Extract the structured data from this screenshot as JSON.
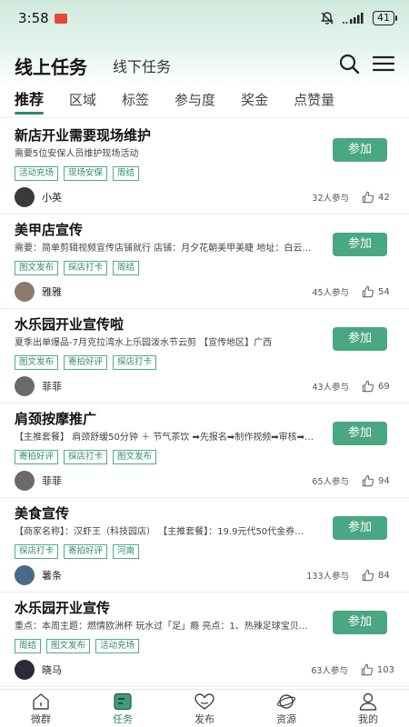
{
  "status": {
    "time": "3:58",
    "battery": "41"
  },
  "top_nav": {
    "online": "线上任务",
    "offline": "线下任务"
  },
  "tabs": [
    "推荐",
    "区域",
    "标签",
    "参与度",
    "奖金",
    "点赞量"
  ],
  "join_label": "参加",
  "tasks": [
    {
      "title": "新店开业需要现场维护",
      "desc": "需要5位安保人员维护现场活动",
      "tags": [
        "活动充场",
        "现场安保",
        "周结"
      ],
      "user": "小英",
      "participants": "32人参与",
      "likes": "42",
      "avatar_color": "#3a3a3a"
    },
    {
      "title": "美甲店宣传",
      "desc": "需要：简单剪辑视频宣传店铺就行 店铺：月夕花朝美甲美睫 地址：白云…",
      "tags": [
        "图文发布",
        "探店打卡",
        "周结"
      ],
      "user": "雅雅",
      "participants": "45人参与",
      "likes": "54",
      "avatar_color": "#8a7a6a"
    },
    {
      "title": "水乐园开业宣传啦",
      "desc": "夏季出单爆品-7月克拉湾水上乐园泼水节云剪 【宣传地区】广西",
      "tags": [
        "图文发布",
        "寄拍好评",
        "探店打卡"
      ],
      "user": "菲菲",
      "participants": "43人参与",
      "likes": "69",
      "avatar_color": "#6a6a6a"
    },
    {
      "title": "肩颈按摩推广",
      "desc": "【主推套餐】 肩颈舒缓50分钟 ＋ 节气茶饮 ➡先报名➡制作视频➡审核➡…",
      "tags": [
        "寄拍好评",
        "探店打卡",
        "图文发布"
      ],
      "user": "菲菲",
      "participants": "65人参与",
      "likes": "94",
      "avatar_color": "#6a6a6a"
    },
    {
      "title": "美食宣传",
      "desc": "【商家名称】：汉虾王（科技园店） 【主推套餐】：19.9元代50代金券…",
      "tags": [
        "探店打卡",
        "寄拍好评",
        "河南"
      ],
      "user": "薯条",
      "participants": "133人参与",
      "likes": "84",
      "avatar_color": "#4a6a8a"
    },
    {
      "title": "水乐园开业宣传",
      "desc": "重点：本周主题：燃情欧洲杯 玩水过「足」瘾 亮点：1、热辣足球宝贝…",
      "tags": [
        "周结",
        "图文发布",
        "活动充场"
      ],
      "user": "晓马",
      "participants": "63人参与",
      "likes": "103",
      "avatar_color": "#2a2a3a"
    }
  ],
  "bottom_nav": [
    "微群",
    "任务",
    "发布",
    "资源",
    "我的"
  ],
  "colors": {
    "accent": "#4aa783",
    "tag": "#2e8b6a"
  }
}
